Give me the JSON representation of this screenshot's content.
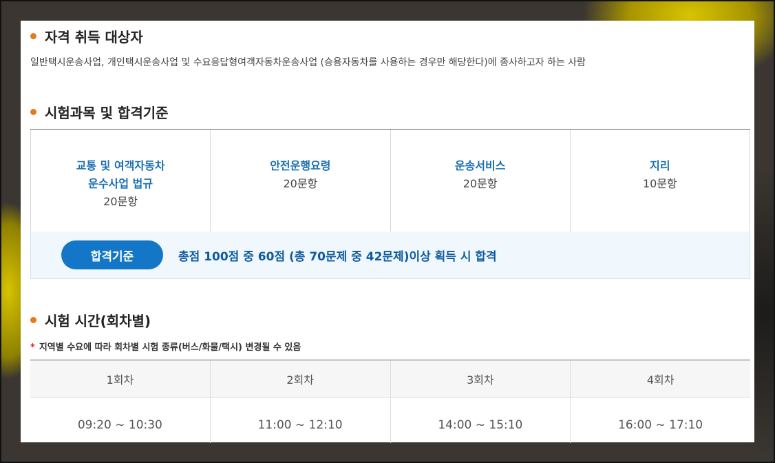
{
  "eligibility": {
    "title": "자격 취득 대상자",
    "description": "일반택시운송사업, 개인택시운송사업 및 수요응답형여객자동차운송사업 (승용자동차를 사용하는 경우만 해당한다)에 종사하고자 하는 사람"
  },
  "subjects": {
    "title": "시험과목 및 합격기준",
    "items": [
      {
        "name_line1": "교통 및 여객자동차",
        "name_line2": "운수사업 법규",
        "count": "20문항"
      },
      {
        "name_line1": "안전운행요령",
        "name_line2": "",
        "count": "20문항"
      },
      {
        "name_line1": "운송서비스",
        "name_line2": "",
        "count": "20문항"
      },
      {
        "name_line1": "지리",
        "name_line2": "",
        "count": "10문항"
      }
    ],
    "pass_label": "합격기준",
    "pass_text": "총점 100점 중 60점 (총 70문제 중 42문제)이상 획득 시 합격"
  },
  "schedule": {
    "title": "시험 시간(회차별)",
    "note_star": "*",
    "note": "지역별 수요에 따라 회차별 시험 종류(버스/화물/택시) 변경될 수 있음",
    "sessions": [
      {
        "label": "1회차",
        "time": "09:20 ~ 10:30"
      },
      {
        "label": "2회차",
        "time": "11:00 ~ 12:10"
      },
      {
        "label": "3회차",
        "time": "14:00 ~ 15:10"
      },
      {
        "label": "4회차",
        "time": "16:00 ~ 17:10"
      }
    ]
  },
  "colors": {
    "accent_bullet": "#e47a1b",
    "subject_blue": "#1a6fb5",
    "badge_blue": "#1476c6",
    "pass_text_blue": "#0e5aa0"
  }
}
